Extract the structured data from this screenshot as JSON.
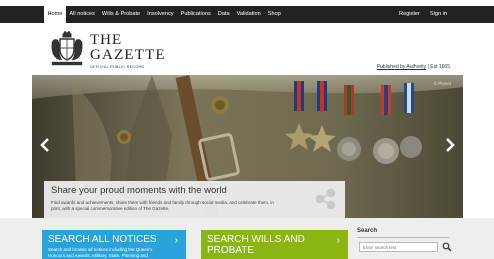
{
  "nav": {
    "items": [
      {
        "label": "Home"
      },
      {
        "label": "All notices"
      },
      {
        "label": "Wills & Probate"
      },
      {
        "label": "Insolvency"
      },
      {
        "label": "Publications"
      },
      {
        "label": "Data"
      },
      {
        "label": "Validation"
      },
      {
        "label": "Shop"
      }
    ],
    "register": "Register",
    "sign_in": "Sign in"
  },
  "brand": {
    "line1": "THE",
    "line2": "GAZETTE",
    "tagline": "OFFICIAL PUBLIC RECORD",
    "crest_icon": "royal-crest-icon"
  },
  "authority": {
    "link": "Published by Authority",
    "sep": " | ",
    "est": "Est 1665"
  },
  "hero": {
    "credit": "© Planet",
    "prev_icon": "chevron-left-icon",
    "next_icon": "chevron-right-icon",
    "caption_title": "Share your proud moments with the world",
    "caption_text": "Find awards and achievements, share them with friends and family through social media, and celebrate them, in print, with a special commemorative edition of The Gazette.",
    "share_icon": "share-icon"
  },
  "cards": {
    "notices": {
      "title": "SEARCH ALL NOTICES",
      "desc": "Search and browse all notices including the Queen's Honours and Awards, Military, State, Planning and",
      "color": "#29a3dc"
    },
    "wills": {
      "title": "SEARCH WILLS AND PROBATE",
      "desc": "",
      "color": "#8ab512"
    }
  },
  "search": {
    "title": "Search",
    "placeholder": "Enter search text",
    "button_icon": "search-icon"
  }
}
